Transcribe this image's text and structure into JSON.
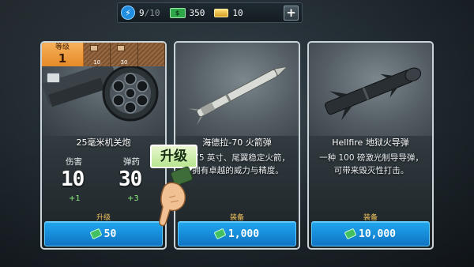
{
  "resources": {
    "energy": {
      "icon": "bolt-icon",
      "value": "9",
      "max": "/10"
    },
    "cash": {
      "icon": "cash-icon",
      "value": "350"
    },
    "gold": {
      "icon": "gold-bar-icon",
      "value": "10"
    },
    "add_icon": "+"
  },
  "cards": [
    {
      "name": "25毫米机关炮",
      "level_label": "等级",
      "level_value": "1",
      "tick_labels": [
        "10",
        "30",
        ""
      ],
      "stats": [
        {
          "label": "伤害",
          "value": "10",
          "delta": "+1"
        },
        {
          "label": "弹药",
          "value": "30",
          "delta": "+3"
        }
      ],
      "footer_label": "升级",
      "price": "50"
    },
    {
      "name": "海德拉-70 火箭弹",
      "description": "2.75 英寸、尾翼稳定火箭，拥有卓越的威力与精度。",
      "footer_label": "装备",
      "price": "1,000"
    },
    {
      "name": "Hellfire 地狱火导弹",
      "description": "一种 100 磅激光制导导弹，可带来毁灭性打击。",
      "footer_label": "装备",
      "price": "10,000"
    }
  ],
  "tutorial": {
    "hint_text": "升级",
    "icon": "pointing-hand-icon"
  },
  "colors": {
    "accent": "#1a8fdb",
    "level_tab": "#f0a040",
    "delta": "#8cf07b",
    "footer_label": "#f1c25c"
  }
}
